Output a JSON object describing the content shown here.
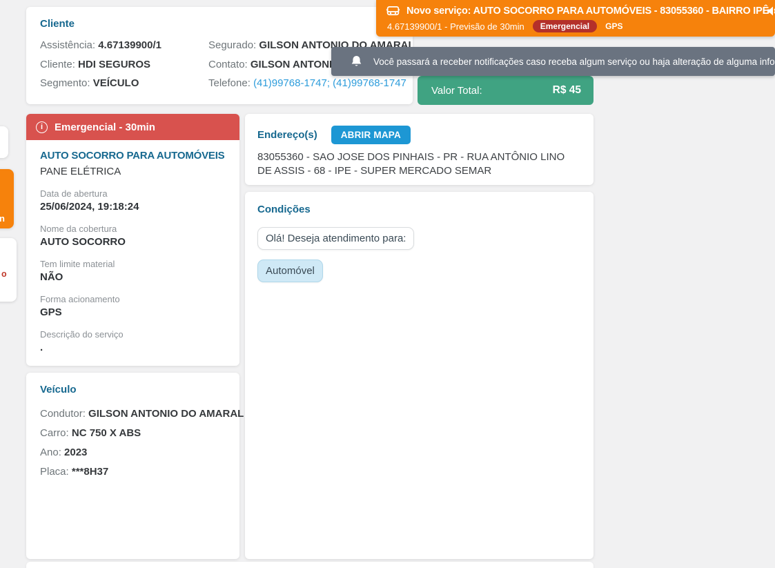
{
  "colors": {
    "accent_blue": "#16688f",
    "link_blue": "#2d9cdb",
    "button_blue": "#1d97d4",
    "banner_orange": "#f6820c",
    "alert_red": "#d8524e",
    "badge_red": "#b4302a",
    "total_green": "#40a382",
    "toast_gray": "#6a7380",
    "background": "#f1f1f2"
  },
  "banner": {
    "title": "Novo serviço: AUTO SOCORRO PARA AUTOMÓVEIS - 83055360 - BAIRRO IPÊ",
    "subtitle": "4.67139900/1 - Previsão de 30min",
    "badge_emergency": "Emergencial",
    "badge_gps": "GPS"
  },
  "toast": {
    "message": "Você passará a receber notificações caso receba algum serviço ou haja alteração de alguma informaçã"
  },
  "client_card": {
    "title": "Cliente",
    "rows_left": [
      {
        "label": "Assistência:",
        "value": "4.67139900/1"
      },
      {
        "label": "Cliente:",
        "value": "HDI SEGUROS"
      },
      {
        "label": "Segmento:",
        "value": "VEÍCULO"
      }
    ],
    "rows_right": [
      {
        "label": "Segurado:",
        "value": "GILSON ANTONIO DO AMARAL"
      },
      {
        "label": "Contato:",
        "value": "GILSON ANTONIO DO AMARAL"
      },
      {
        "label": "Telefone:",
        "value": "(41)99768-1747; (41)99768-1747"
      }
    ]
  },
  "total_card": {
    "label": "Valor Total:",
    "value": "R$ 45"
  },
  "service_card": {
    "header": "Emergencial - 30min",
    "name": "AUTO SOCORRO PARA AUTOMÓVEIS",
    "subtype": "PANE ELÉTRICA",
    "details": [
      {
        "label": "Data de abertura",
        "value": "25/06/2024, 19:18:24"
      },
      {
        "label": "Nome da cobertura",
        "value": "AUTO SOCORRO"
      },
      {
        "label": "Tem limite material",
        "value": "NÃO"
      },
      {
        "label": "Forma acionamento",
        "value": "GPS"
      },
      {
        "label": "Descrição do serviço",
        "value": "."
      }
    ]
  },
  "vehicle_card": {
    "title": "Veículo",
    "rows": [
      {
        "label": "Condutor:",
        "value": "GILSON ANTONIO DO AMARAL"
      },
      {
        "label": "Carro:",
        "value": "NC 750 X ABS"
      },
      {
        "label": "Ano:",
        "value": "2023"
      },
      {
        "label": "Placa:",
        "value": "***8H37"
      }
    ]
  },
  "address_card": {
    "title": "Endereço(s)",
    "map_button": "ABRIR MAPA",
    "address": "83055360 - SAO JOSE DOS PINHAIS - PR - RUA ANTÔNIO LINO DE ASSIS - 68 - IPE - SUPER MERCADO SEMAR"
  },
  "conditions_card": {
    "title": "Condições",
    "bot_message": "Olá! Deseja atendimento para:",
    "option": "Automóvel"
  },
  "left_fragments": {
    "orange_text": "n",
    "red_text": "o"
  },
  "info_icon_glyph": "i"
}
